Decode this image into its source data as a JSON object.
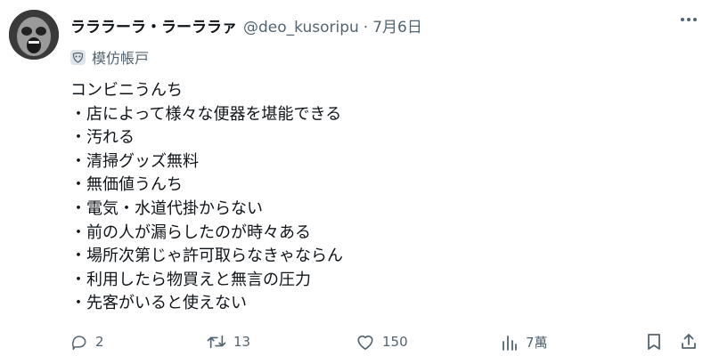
{
  "post": {
    "display_name": "ラララーラ・ラーララァ",
    "handle": "@deo_kusoripu",
    "separator": "·",
    "date": "7月6日",
    "label": "模仿帳戸",
    "lines": [
      "コンビニうんち",
      "・店によって様々な便器を堪能できる",
      "・汚れる",
      "・清掃グッズ無料",
      "・無価値うんち",
      "・電気・水道代掛からない",
      "・前の人が漏らしたのが時々ある",
      "・場所次第じゃ許可取らなきゃならん",
      "・利用したら物買えと無言の圧力",
      "・先客がいると使えない"
    ]
  },
  "actions": {
    "replies": "2",
    "reposts": "13",
    "likes": "150",
    "views": "7萬"
  },
  "icons": {
    "avatar": "avatar-image",
    "label": "mask-icon",
    "reply": "reply-icon",
    "repost": "repost-icon",
    "like": "heart-icon",
    "views": "views-icon",
    "bookmark": "bookmark-icon",
    "share": "share-icon",
    "more": "more-icon"
  },
  "colors": {
    "text": "#0f1419",
    "secondary": "#536471"
  }
}
